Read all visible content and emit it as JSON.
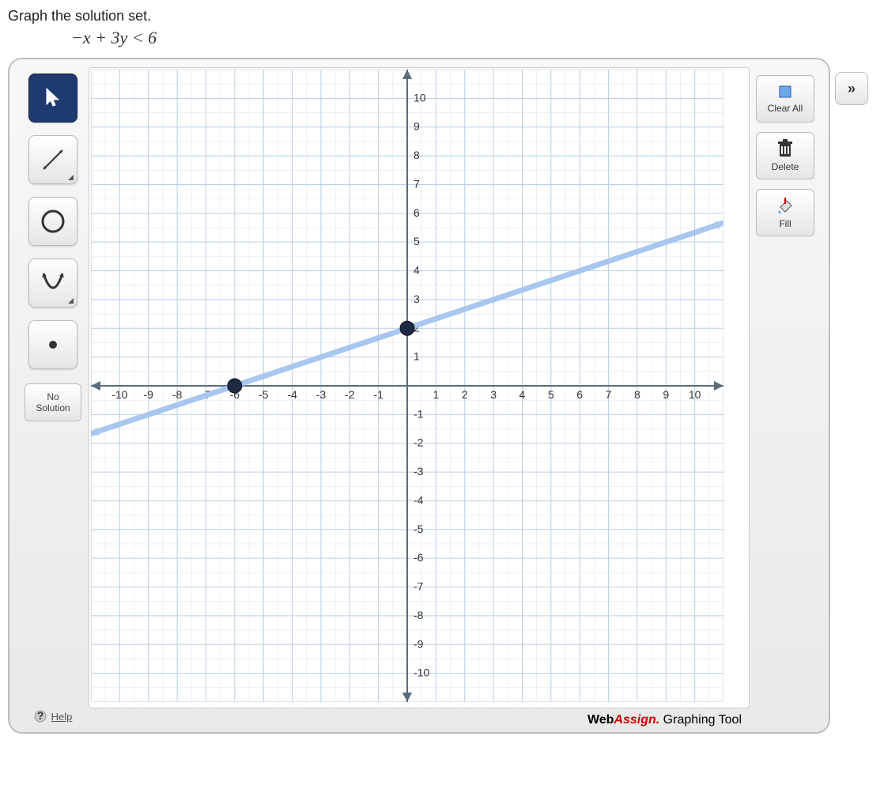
{
  "instruction": "Graph the solution set.",
  "equation": "−x + 3y < 6",
  "left_tools": {
    "select": "select-tool",
    "line": "line-tool",
    "circle": "circle-tool",
    "parabola": "parabola-tool",
    "point": "point-tool"
  },
  "no_solution": {
    "line1": "No",
    "line2": "Solution"
  },
  "help_label": "Help",
  "right_tools": {
    "clearall": "Clear All",
    "delete": "Delete",
    "fill": "Fill"
  },
  "expand_label": "»",
  "brand": {
    "part1": "Web",
    "part2": "Assign.",
    "tail": " Graphing Tool"
  },
  "chart_data": {
    "type": "line",
    "title": "",
    "xlabel": "",
    "ylabel": "",
    "xlim": [
      -11,
      11
    ],
    "ylim": [
      -11,
      11
    ],
    "xticks": [
      -10,
      -9,
      -8,
      -7,
      -6,
      -5,
      -4,
      -3,
      -2,
      -1,
      1,
      2,
      3,
      4,
      5,
      6,
      7,
      8,
      9,
      10
    ],
    "yticks": [
      -10,
      -9,
      -8,
      -7,
      -6,
      -5,
      -4,
      -3,
      -2,
      -1,
      1,
      2,
      3,
      4,
      5,
      6,
      7,
      8,
      9,
      10
    ],
    "grid": true,
    "line": {
      "style": "dashed_light",
      "equation": "y = (x + 6) / 3",
      "points": [
        [
          -6,
          0
        ],
        [
          0,
          2
        ]
      ]
    },
    "handles": [
      [
        -6,
        0
      ],
      [
        0,
        2
      ]
    ]
  }
}
